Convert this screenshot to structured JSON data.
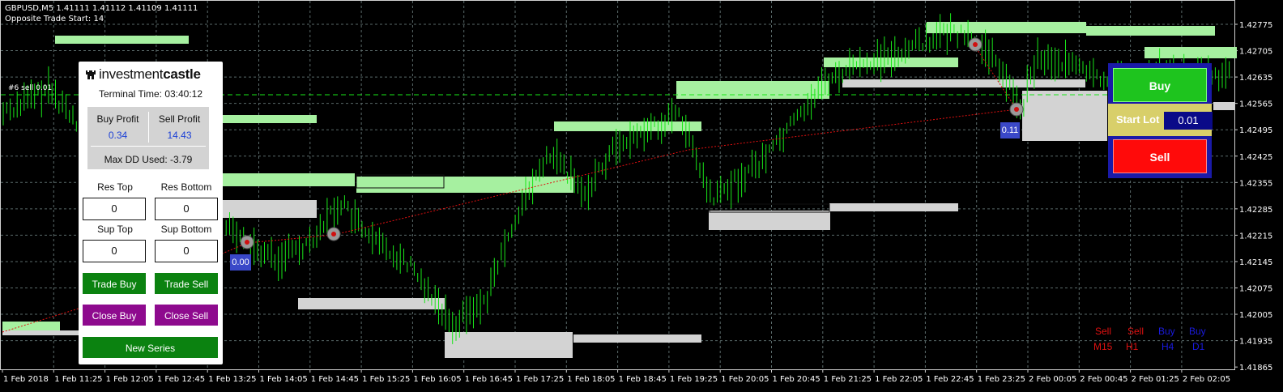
{
  "chart": {
    "info_line1": "GBPUSD,M5  1.41111 1.41112 1.41109 1.41111",
    "info_line2": "Opposite Trade Start: 14",
    "order_label": "#6 sell 0.01",
    "price_axis": [
      "1.42775",
      "1.42705",
      "1.42635",
      "1.42565",
      "1.42495",
      "1.42425",
      "1.42355",
      "1.42285",
      "1.42215",
      "1.42145",
      "1.42075",
      "1.42005",
      "1.41935",
      "1.41865"
    ],
    "time_axis": [
      "1 Feb 2018",
      "1 Feb 11:25",
      "1 Feb 12:05",
      "1 Feb 12:45",
      "1 Feb 13:25",
      "1 Feb 14:05",
      "1 Feb 14:45",
      "1 Feb 15:25",
      "1 Feb 16:05",
      "1 Feb 16:45",
      "1 Feb 17:25",
      "1 Feb 18:05",
      "1 Feb 18:45",
      "1 Feb 19:25",
      "1 Feb 20:05",
      "1 Feb 20:45",
      "1 Feb 21:25",
      "1 Feb 22:05",
      "1 Feb 22:45",
      "1 Feb 23:25",
      "2 Feb 00:05",
      "2 Feb 00:45",
      "2 Feb 01:25",
      "2 Feb 02:05"
    ],
    "tag_left": "0.00",
    "tag_right": "0.11"
  },
  "colors": {
    "candle": "#19e619",
    "supply_zone": "#a6f0a0",
    "demand_zone": "#d3d3d3",
    "grid": "#5a6a6a",
    "trend_line": "#e01010",
    "sell_text": "#e01010",
    "buy_text": "#1a1adf"
  },
  "timeframes": [
    {
      "signal": "Sell",
      "tf": "M15",
      "color": "#e01010"
    },
    {
      "signal": "Sell",
      "tf": "H1",
      "color": "#e01010"
    },
    {
      "signal": "Buy",
      "tf": "H4",
      "color": "#1a1adf"
    },
    {
      "signal": "Buy",
      "tf": "D1",
      "color": "#1a1adf"
    }
  ],
  "panel": {
    "logo_light": "investment",
    "logo_bold": "castle",
    "terminal_time": "Terminal Time: 03:40:12",
    "buy_profit_label": "Buy Profit",
    "buy_profit_value": "0.34",
    "sell_profit_label": "Sell Profit",
    "sell_profit_value": "14.43",
    "max_dd": "Max DD Used: -3.79",
    "res_top_label": "Res Top",
    "res_top_value": "0",
    "res_bottom_label": "Res Bottom",
    "res_bottom_value": "0",
    "sup_top_label": "Sup Top",
    "sup_top_value": "0",
    "sup_bottom_label": "Sup Bottom",
    "sup_bottom_value": "0",
    "trade_buy": "Trade Buy",
    "trade_sell": "Trade Sell",
    "close_buy": "Close Buy",
    "close_sell": "Close Sell",
    "new_series": "New Series"
  },
  "tradebox": {
    "buy_label": "Buy",
    "start_lot_label": "Start Lot",
    "start_lot_value": "0.01",
    "sell_label": "Sell"
  }
}
